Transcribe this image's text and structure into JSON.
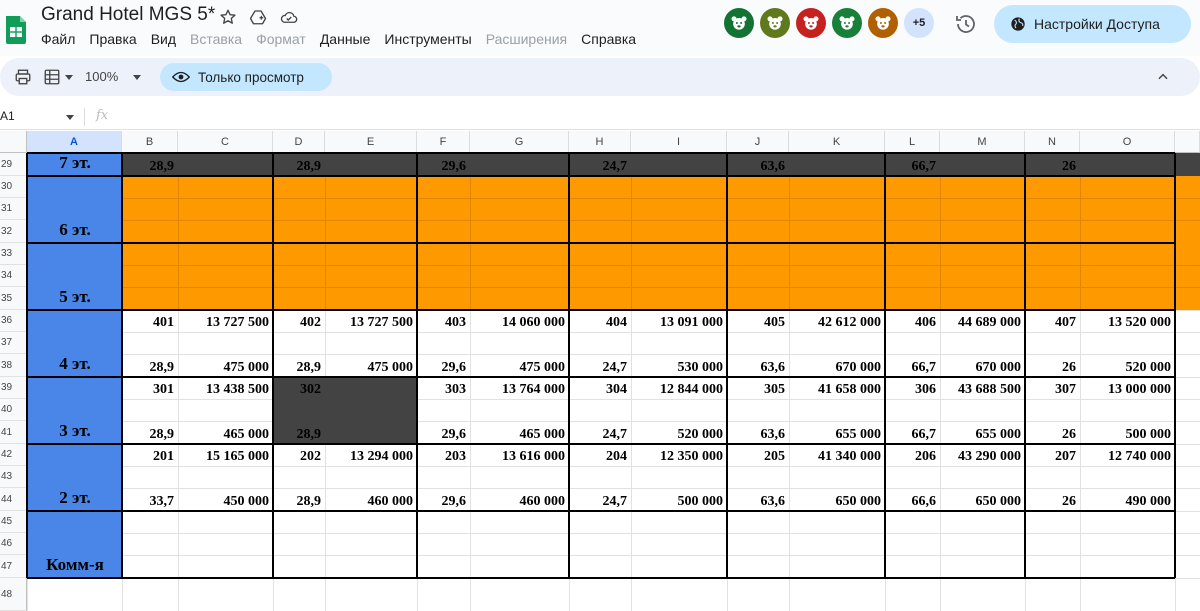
{
  "app": {
    "doc_title": "Grand Hotel MGS 5*",
    "menu": [
      {
        "label": "Файл",
        "enabled": true
      },
      {
        "label": "Правка",
        "enabled": true
      },
      {
        "label": "Вид",
        "enabled": true
      },
      {
        "label": "Вставка",
        "enabled": false
      },
      {
        "label": "Формат",
        "enabled": false
      },
      {
        "label": "Данные",
        "enabled": true
      },
      {
        "label": "Инструменты",
        "enabled": true
      },
      {
        "label": "Расширения",
        "enabled": false
      },
      {
        "label": "Справка",
        "enabled": true
      }
    ],
    "collaborators": [
      {
        "icon": "bear-avatar-icon",
        "color": "#137333"
      },
      {
        "icon": "platypus-avatar-icon",
        "color": "#5f7a1c"
      },
      {
        "icon": "bison-avatar-icon",
        "color": "#c5221f"
      },
      {
        "icon": "hedgehog-avatar-icon",
        "color": "#188038"
      },
      {
        "icon": "lion-avatar-icon",
        "color": "#b06000"
      }
    ],
    "more_collaborators": "+5",
    "share_label": "Настройки Доступа"
  },
  "toolbar": {
    "zoom": "100%",
    "view_only_label": "Только просмотр"
  },
  "formula_bar": {
    "name_box": "A1",
    "fx": "fx"
  },
  "grid": {
    "columns": [
      "A",
      "B",
      "C",
      "D",
      "E",
      "F",
      "G",
      "H",
      "I",
      "J",
      "K",
      "L",
      "M",
      "N",
      "O"
    ],
    "selected_column": "A",
    "rows": [
      "29",
      "30",
      "31",
      "32",
      "33",
      "34",
      "35",
      "36",
      "37",
      "38",
      "39",
      "40",
      "41",
      "42",
      "43",
      "44",
      "45",
      "46",
      "47",
      "48"
    ],
    "colors": {
      "floor_label_bg": "#4a86e8",
      "orange_fill": "#ff9900",
      "dark_fill": "#434343"
    },
    "floors": [
      {
        "label": "7 эт.",
        "rooms": [
          {
            "area": "28,9"
          },
          {
            "area": "28,9"
          },
          {
            "area": "29,6"
          },
          {
            "area": "24,7"
          },
          {
            "area": "63,6"
          },
          {
            "area": "66,7"
          },
          {
            "area": "26"
          }
        ]
      },
      {
        "label": "6 эт."
      },
      {
        "label": "5 эт."
      },
      {
        "label": "4 эт.",
        "rooms": [
          {
            "number": "401",
            "price": "13 727 500",
            "area": "28,9",
            "price_m2": "475 000"
          },
          {
            "number": "402",
            "price": "13 727 500",
            "area": "28,9",
            "price_m2": "475 000"
          },
          {
            "number": "403",
            "price": "14 060 000",
            "area": "29,6",
            "price_m2": "475 000"
          },
          {
            "number": "404",
            "price": "13 091 000",
            "area": "24,7",
            "price_m2": "530 000"
          },
          {
            "number": "405",
            "price": "42 612 000",
            "area": "63,6",
            "price_m2": "670 000"
          },
          {
            "number": "406",
            "price": "44 689 000",
            "area": "66,7",
            "price_m2": "670 000"
          },
          {
            "number": "407",
            "price": "13 520 000",
            "area": "26",
            "price_m2": "520 000"
          }
        ]
      },
      {
        "label": "3 эт.",
        "rooms": [
          {
            "number": "301",
            "price": "13 438 500",
            "area": "28,9",
            "price_m2": "465 000"
          },
          {
            "number": "302",
            "price": "",
            "area": "28,9",
            "price_m2": "",
            "sold": true
          },
          {
            "number": "303",
            "price": "13 764 000",
            "area": "29,6",
            "price_m2": "465 000"
          },
          {
            "number": "304",
            "price": "12 844 000",
            "area": "24,7",
            "price_m2": "520 000"
          },
          {
            "number": "305",
            "price": "41 658 000",
            "area": "63,6",
            "price_m2": "655 000"
          },
          {
            "number": "306",
            "price": "43 688 500",
            "area": "66,7",
            "price_m2": "655 000"
          },
          {
            "number": "307",
            "price": "13 000 000",
            "area": "26",
            "price_m2": "500 000"
          }
        ]
      },
      {
        "label": "2 эт.",
        "rooms": [
          {
            "number": "201",
            "price": "15 165 000",
            "area": "33,7",
            "price_m2": "450 000"
          },
          {
            "number": "202",
            "price": "13 294 000",
            "area": "28,9",
            "price_m2": "460 000"
          },
          {
            "number": "203",
            "price": "13 616 000",
            "area": "29,6",
            "price_m2": "460 000"
          },
          {
            "number": "204",
            "price": "12 350 000",
            "area": "24,7",
            "price_m2": "500 000"
          },
          {
            "number": "205",
            "price": "41 340 000",
            "area": "63,6",
            "price_m2": "650 000"
          },
          {
            "number": "206",
            "price": "43 290 000",
            "area": "66,6",
            "price_m2": "650 000"
          },
          {
            "number": "207",
            "price": "12 740 000",
            "area": "26",
            "price_m2": "490 000"
          }
        ]
      },
      {
        "label": "Комм-я"
      }
    ]
  }
}
